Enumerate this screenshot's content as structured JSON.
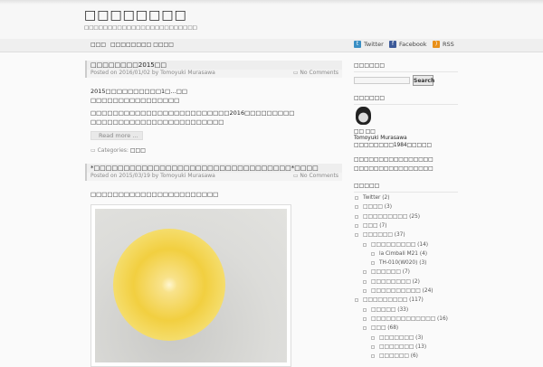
{
  "site": {
    "title": "□□□□□□□□",
    "tagline": "□□□□□□□□□□□□□□□□□□□□□□□□"
  },
  "nav": {
    "items": [
      "□□□",
      "□□□□□□□□ □□□□"
    ],
    "social": [
      "Twitter",
      "Facebook",
      "RSS"
    ]
  },
  "posts": [
    {
      "title": "□□□□□□□□2015□□",
      "meta": "Posted on 2016/01/02 by Tomoyuki Murasawa",
      "comments": "No Comments",
      "paragraphs": [
        "2015□□□□□□□□□□1□…□□",
        "□□□□□□□□□□□□□□□□",
        "□□□□□□□□□□□□□□□□□□□□□□□□□2016□□□□□□□□□",
        "□□□□□□□□□□□□□□□□□□□□□□□□"
      ],
      "read_more": "Read more …",
      "categories_label": "Categories:",
      "category": "□□□"
    },
    {
      "title": "*□□□□□□□□□□□□□□□□□□□□□□□□□□□□□□□□□*□□□□",
      "meta": "Posted on 2015/03/19 by Tomoyuki Murasawa",
      "comments": "No Comments",
      "paragraphs": [
        "□□□□□□□□□□□□□□□□□□□□□□□"
      ]
    }
  ],
  "sidebar": {
    "search_heading": "□□□□□□",
    "search_button": "Search",
    "profile_heading": "□□□□□□",
    "profile_name_jp": "□□ □□",
    "profile_name": "Tomoyuki Murasawa",
    "profile_born": "□□□□□□□□1984□□□□□",
    "profile_lines": [
      "□□□□□□□□□□□□□□□□",
      "□□□□□□□□□□□□□□□□"
    ],
    "categories_heading": "□□□□□",
    "categories": [
      {
        "label": "Twitter (2)",
        "level": 0
      },
      {
        "label": "□□□□ (3)",
        "level": 0
      },
      {
        "label": "□□□□□□□□□ (25)",
        "level": 0
      },
      {
        "label": "□□□ (7)",
        "level": 0
      },
      {
        "label": "□□□□□□ (37)",
        "level": 0
      },
      {
        "label": "□□□□□□□□□ (14)",
        "level": 1
      },
      {
        "label": "la Cimbali M21 (4)",
        "level": 2
      },
      {
        "label": "TH-010(W020) (3)",
        "level": 2
      },
      {
        "label": "□□□□□□ (7)",
        "level": 1
      },
      {
        "label": "□□□□□□□□ (2)",
        "level": 1
      },
      {
        "label": "□□□□□□□□□□ (24)",
        "level": 1
      },
      {
        "label": "□□□□□□□□□ (117)",
        "level": 0
      },
      {
        "label": "□□□□□ (33)",
        "level": 1
      },
      {
        "label": "□□□□□□□□□□□□□ (16)",
        "level": 1
      },
      {
        "label": "□□□ (68)",
        "level": 1
      },
      {
        "label": "□□□□□□□ (3)",
        "level": 2
      },
      {
        "label": "□□□□□□□ (13)",
        "level": 2
      },
      {
        "label": "□□□□□□ (6)",
        "level": 2
      }
    ]
  }
}
